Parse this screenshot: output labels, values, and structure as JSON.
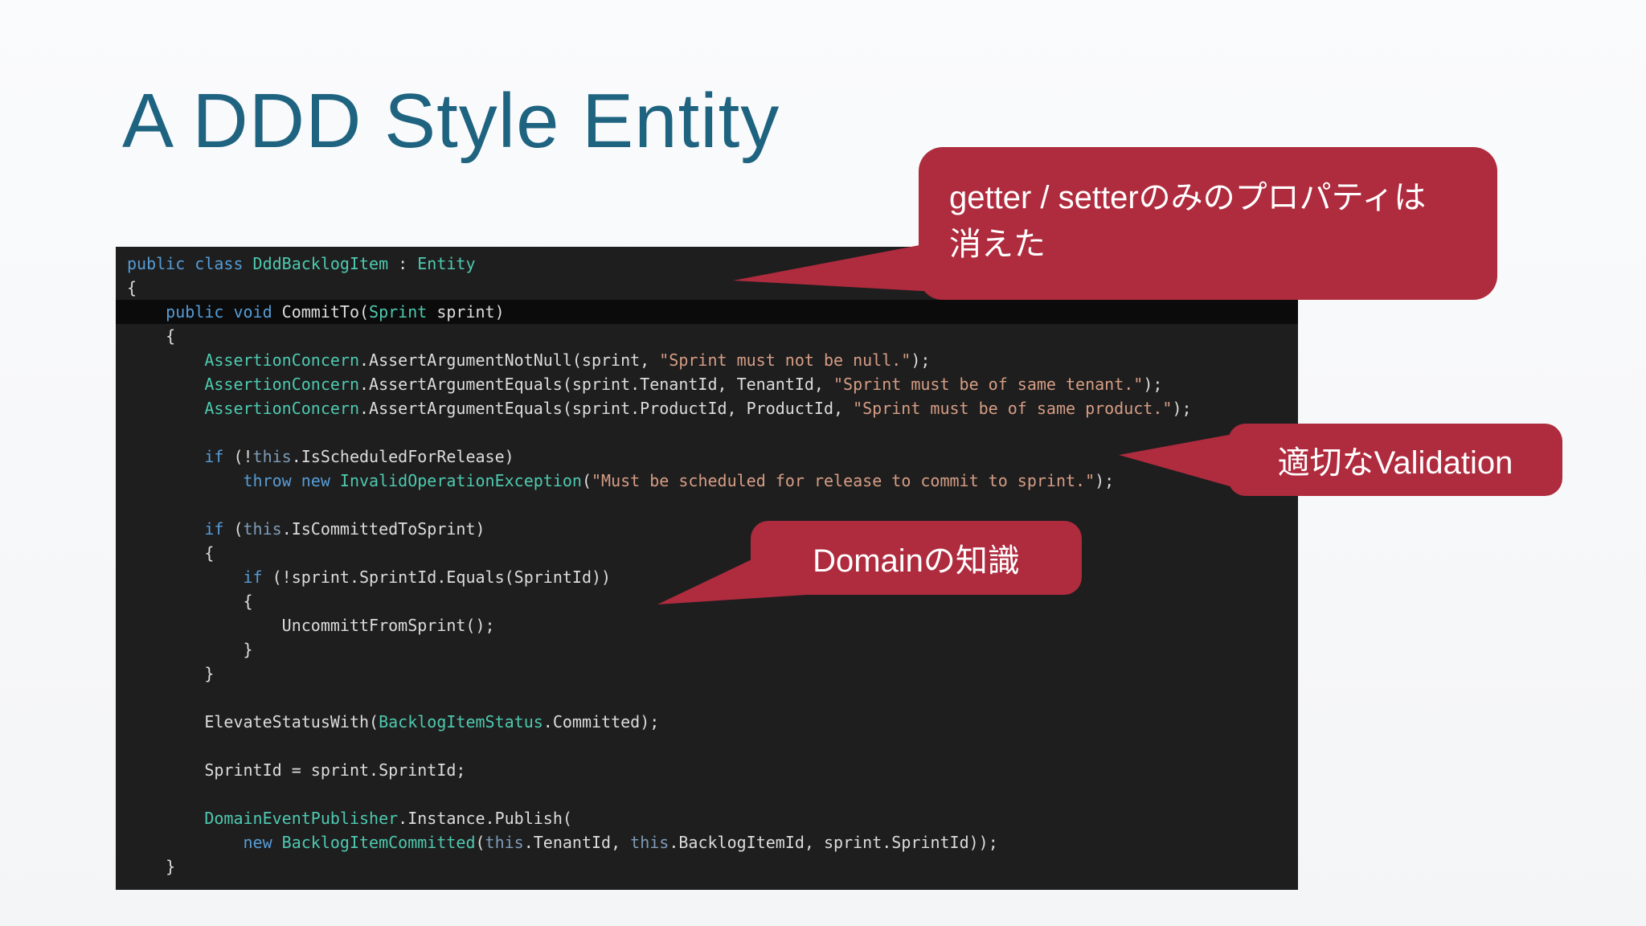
{
  "slide": {
    "title": "A DDD Style Entity"
  },
  "callouts": {
    "getter_setter_line1": "getter / setterのみのプロパティは",
    "getter_setter_line2": "消えた",
    "validation": "適切なValidation",
    "domain": "Domainの知識"
  },
  "colors": {
    "title": "#1e6380",
    "callout_red": "#af2b3e",
    "editor_bg": "#1e1e1e",
    "token_keyword": "#569cd6",
    "token_type": "#4ec9b0",
    "token_string": "#d69d85",
    "token_plain": "#dcdcdc",
    "token_this": "#7f9cb8"
  },
  "code": {
    "lines": [
      {
        "tk": [
          [
            "k",
            "public class "
          ],
          [
            "t",
            "DddBacklogItem"
          ],
          [
            "p",
            " : "
          ],
          [
            "t",
            "Entity"
          ]
        ]
      },
      {
        "tk": [
          [
            "p",
            "{"
          ]
        ]
      },
      {
        "hl": true,
        "tk": [
          [
            "p",
            "    "
          ],
          [
            "k",
            "public void "
          ],
          [
            "p",
            "CommitTo("
          ],
          [
            "t",
            "Sprint"
          ],
          [
            "p",
            " sprint)"
          ]
        ]
      },
      {
        "tk": [
          [
            "p",
            "    {"
          ]
        ]
      },
      {
        "tk": [
          [
            "p",
            "        "
          ],
          [
            "t",
            "AssertionConcern"
          ],
          [
            "p",
            ".AssertArgumentNotNull(sprint, "
          ],
          [
            "s",
            "\"Sprint must not be null.\""
          ],
          [
            "p",
            ");"
          ]
        ]
      },
      {
        "tk": [
          [
            "p",
            "        "
          ],
          [
            "t",
            "AssertionConcern"
          ],
          [
            "p",
            ".AssertArgumentEquals(sprint.TenantId, TenantId, "
          ],
          [
            "s",
            "\"Sprint must be of same tenant.\""
          ],
          [
            "p",
            ");"
          ]
        ]
      },
      {
        "tk": [
          [
            "p",
            "        "
          ],
          [
            "t",
            "AssertionConcern"
          ],
          [
            "p",
            ".AssertArgumentEquals(sprint.ProductId, ProductId, "
          ],
          [
            "s",
            "\"Sprint must be of same product.\""
          ],
          [
            "p",
            ");"
          ]
        ]
      },
      {
        "tk": []
      },
      {
        "tk": [
          [
            "p",
            "        "
          ],
          [
            "k",
            "if"
          ],
          [
            "p",
            " (!"
          ],
          [
            "th",
            "this"
          ],
          [
            "p",
            ".IsScheduledForRelease)"
          ]
        ]
      },
      {
        "tk": [
          [
            "p",
            "            "
          ],
          [
            "k",
            "throw new "
          ],
          [
            "t",
            "InvalidOperationException"
          ],
          [
            "p",
            "("
          ],
          [
            "s",
            "\"Must be scheduled for release to commit to sprint.\""
          ],
          [
            "p",
            ");"
          ]
        ]
      },
      {
        "tk": []
      },
      {
        "tk": [
          [
            "p",
            "        "
          ],
          [
            "k",
            "if"
          ],
          [
            "p",
            " ("
          ],
          [
            "th",
            "this"
          ],
          [
            "p",
            ".IsCommittedToSprint)"
          ]
        ]
      },
      {
        "tk": [
          [
            "p",
            "        {"
          ]
        ]
      },
      {
        "tk": [
          [
            "p",
            "            "
          ],
          [
            "k",
            "if"
          ],
          [
            "p",
            " (!sprint.SprintId.Equals(SprintId))"
          ]
        ]
      },
      {
        "tk": [
          [
            "p",
            "            {"
          ]
        ]
      },
      {
        "tk": [
          [
            "p",
            "                UncommittFromSprint();"
          ]
        ]
      },
      {
        "tk": [
          [
            "p",
            "            }"
          ]
        ]
      },
      {
        "tk": [
          [
            "p",
            "        }"
          ]
        ]
      },
      {
        "tk": []
      },
      {
        "tk": [
          [
            "p",
            "        ElevateStatusWith("
          ],
          [
            "t",
            "BacklogItemStatus"
          ],
          [
            "p",
            ".Committed);"
          ]
        ]
      },
      {
        "tk": []
      },
      {
        "tk": [
          [
            "p",
            "        SprintId = sprint.SprintId;"
          ]
        ]
      },
      {
        "tk": []
      },
      {
        "tk": [
          [
            "p",
            "        "
          ],
          [
            "t",
            "DomainEventPublisher"
          ],
          [
            "p",
            ".Instance.Publish("
          ]
        ]
      },
      {
        "tk": [
          [
            "p",
            "            "
          ],
          [
            "k",
            "new "
          ],
          [
            "t",
            "BacklogItemCommitted"
          ],
          [
            "p",
            "("
          ],
          [
            "th",
            "this"
          ],
          [
            "p",
            ".TenantId, "
          ],
          [
            "th",
            "this"
          ],
          [
            "p",
            ".BacklogItemId, sprint.SprintId));"
          ]
        ]
      },
      {
        "tk": [
          [
            "p",
            "    }"
          ]
        ]
      }
    ]
  }
}
